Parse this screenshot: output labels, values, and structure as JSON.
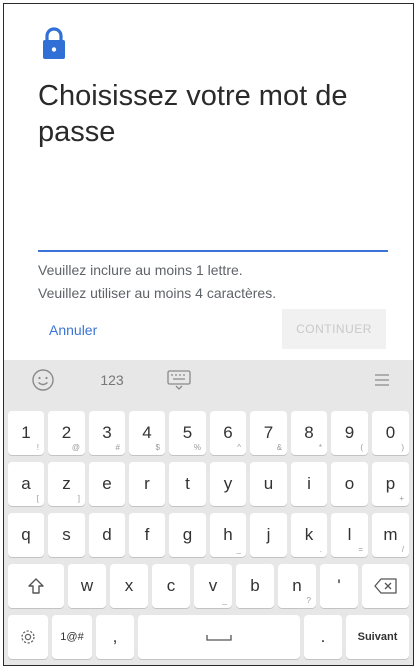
{
  "page": {
    "title": "Choisissez votre mot de passe",
    "hints": [
      "Veuillez inclure au moins 1 lettre.",
      "Veuillez utiliser au moins 4 caractères."
    ],
    "cancel_label": "Annuler",
    "continue_label": "CONTINUER",
    "accent_color": "#3b74d6"
  },
  "keyboard": {
    "toolbar": {
      "numbers_label": "123",
      "icons": [
        "emoji-icon",
        "keyboard-hide-icon",
        "menu-icon"
      ]
    },
    "row1": [
      {
        "label": "1",
        "sub": "!"
      },
      {
        "label": "2",
        "sub": "@"
      },
      {
        "label": "3",
        "sub": "#"
      },
      {
        "label": "4",
        "sub": "$"
      },
      {
        "label": "5",
        "sub": "%"
      },
      {
        "label": "6",
        "sub": "^"
      },
      {
        "label": "7",
        "sub": "&"
      },
      {
        "label": "8",
        "sub": "*"
      },
      {
        "label": "9",
        "sub": "("
      },
      {
        "label": "0",
        "sub": ")"
      }
    ],
    "row2": [
      {
        "label": "a",
        "sub": "["
      },
      {
        "label": "z",
        "sub": "]"
      },
      {
        "label": "e",
        "sub": ""
      },
      {
        "label": "r",
        "sub": ""
      },
      {
        "label": "t",
        "sub": ""
      },
      {
        "label": "y",
        "sub": ""
      },
      {
        "label": "u",
        "sub": ""
      },
      {
        "label": "i",
        "sub": ""
      },
      {
        "label": "o",
        "sub": ""
      },
      {
        "label": "p",
        "sub": "+"
      }
    ],
    "row3": [
      {
        "label": "q",
        "sub": ""
      },
      {
        "label": "s",
        "sub": ""
      },
      {
        "label": "d",
        "sub": ""
      },
      {
        "label": "f",
        "sub": ""
      },
      {
        "label": "g",
        "sub": ""
      },
      {
        "label": "h",
        "sub": "_"
      },
      {
        "label": "j",
        "sub": ""
      },
      {
        "label": "k",
        "sub": "."
      },
      {
        "label": "l",
        "sub": "="
      },
      {
        "label": "m",
        "sub": "/"
      }
    ],
    "row4": [
      {
        "label": "w",
        "sub": ""
      },
      {
        "label": "x",
        "sub": ""
      },
      {
        "label": "c",
        "sub": ""
      },
      {
        "label": "v",
        "sub": "_"
      },
      {
        "label": "b",
        "sub": ""
      },
      {
        "label": "n",
        "sub": "?"
      },
      {
        "label": "'",
        "sub": ""
      }
    ],
    "row5": {
      "symbols_label": "1@#",
      "comma_label": ",",
      "period_label": ".",
      "next_label": "Suivant"
    }
  }
}
